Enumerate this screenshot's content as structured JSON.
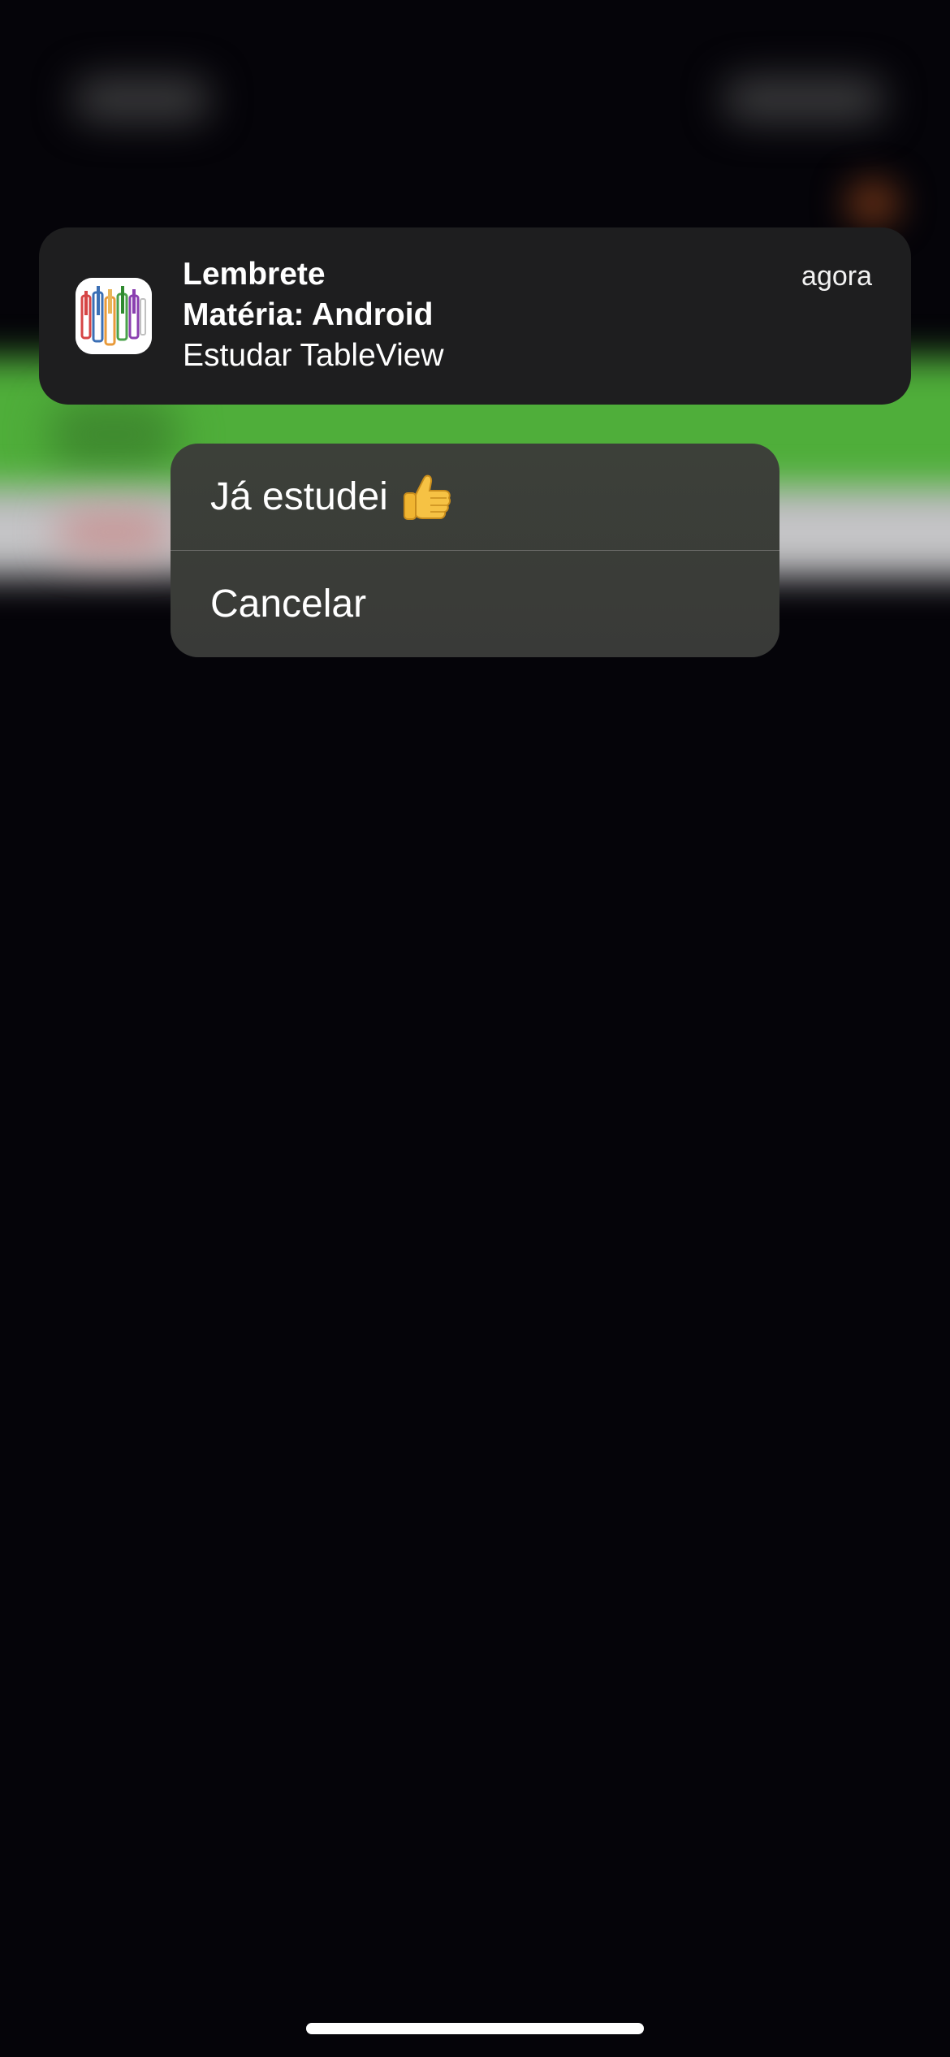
{
  "notification": {
    "app_icon": "books-app-icon",
    "title": "Lembrete",
    "subtitle": "Matéria: Android",
    "body": "Estudar TableView",
    "time": "agora"
  },
  "actions": [
    {
      "label": "Já estudei",
      "icon": "thumbs-up-emoji"
    },
    {
      "label": "Cancelar"
    }
  ],
  "colors": {
    "notification_bg": "#1e1e1f",
    "menu_bg": "#3b3e39",
    "screen_bg": "#050409",
    "background_green": "#4fae3a"
  }
}
